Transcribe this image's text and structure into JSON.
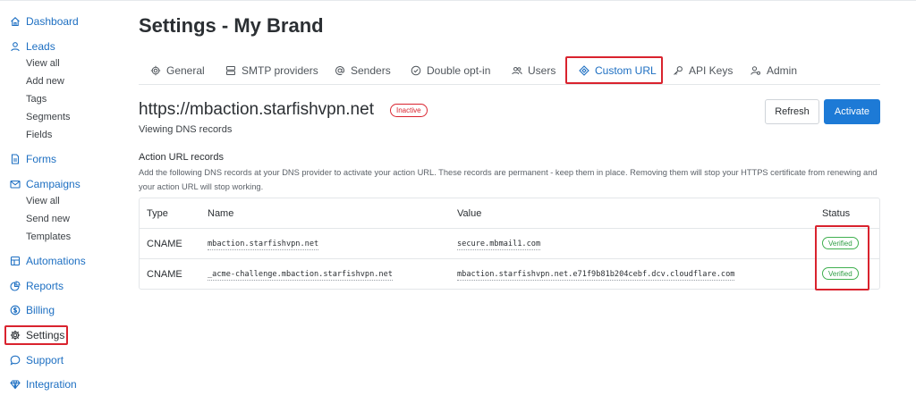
{
  "sidebar": {
    "items": [
      {
        "label": "Dashboard",
        "icon": "home-icon"
      },
      {
        "label": "Leads",
        "icon": "user-icon",
        "children": [
          "View all",
          "Add new",
          "Tags",
          "Segments",
          "Fields"
        ]
      },
      {
        "label": "Forms",
        "icon": "document-icon"
      },
      {
        "label": "Campaigns",
        "icon": "envelope-icon",
        "children": [
          "View all",
          "Send new",
          "Templates"
        ]
      },
      {
        "label": "Automations",
        "icon": "automation-icon"
      },
      {
        "label": "Reports",
        "icon": "chart-pie-icon"
      },
      {
        "label": "Billing",
        "icon": "dollar-circle-icon"
      },
      {
        "label": "Settings",
        "icon": "gear-icon",
        "active": true
      },
      {
        "label": "Support",
        "icon": "chat-bubble-icon"
      },
      {
        "label": "Integration",
        "icon": "diamond-icon"
      }
    ]
  },
  "page": {
    "title": "Settings - My Brand"
  },
  "tabs": [
    {
      "label": "General",
      "icon": "gear-icon"
    },
    {
      "label": "SMTP providers",
      "icon": "server-icon"
    },
    {
      "label": "Senders",
      "icon": "at-sign-icon"
    },
    {
      "label": "Double opt-in",
      "icon": "check-circle-icon"
    },
    {
      "label": "Users",
      "icon": "users-icon"
    },
    {
      "label": "Custom URL",
      "icon": "diamond-icon",
      "active": true
    },
    {
      "label": "API Keys",
      "icon": "key-icon"
    },
    {
      "label": "Admin",
      "icon": "user-gear-icon"
    }
  ],
  "domain": {
    "url": "https://mbaction.starfishvpn.net",
    "status": "Inactive",
    "subtitle": "Viewing DNS records"
  },
  "buttons": {
    "refresh": "Refresh",
    "activate": "Activate"
  },
  "records": {
    "title": "Action URL records",
    "description": "Add the following DNS records at your DNS provider to activate your action URL. These records are permanent - keep them in place. Removing them will stop your HTTPS certificate from renewing and your action URL will stop working.",
    "columns": [
      "Type",
      "Name",
      "Value",
      "Status"
    ],
    "rows": [
      {
        "type": "CNAME",
        "name": "mbaction.starfishvpn.net",
        "value": "secure.mbmail1.com",
        "status": "Verified"
      },
      {
        "type": "CNAME",
        "name": "_acme-challenge.mbaction.starfishvpn.net",
        "value": "mbaction.starfishvpn.net.e71f9b81b204cebf.dcv.cloudflare.com",
        "status": "Verified"
      }
    ]
  },
  "colors": {
    "accent": "#1d7ad6",
    "link": "#1d6fc2",
    "highlight": "#d9232e",
    "verified": "#2f9e44",
    "inactive": "#d9232e"
  }
}
